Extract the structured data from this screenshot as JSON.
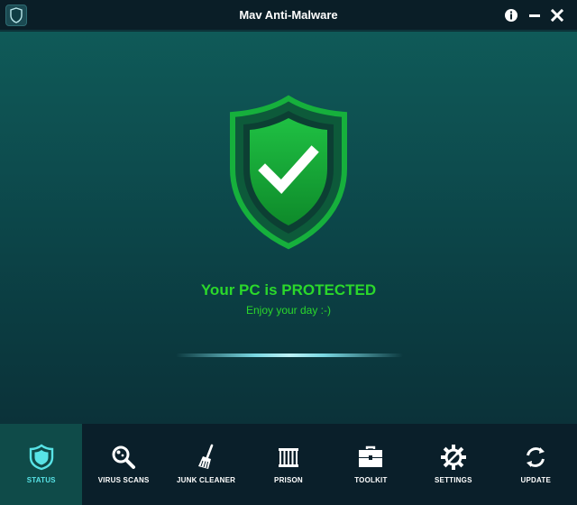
{
  "window": {
    "title": "Mav Anti-Malware"
  },
  "status": {
    "headline": "Your PC is PROTECTED",
    "subtext": "Enjoy your day :-)"
  },
  "nav": {
    "items": [
      {
        "label": "STATUS",
        "icon": "shield-icon",
        "active": true
      },
      {
        "label": "VIRUS SCANS",
        "icon": "magnifier-icon",
        "active": false
      },
      {
        "label": "JUNK CLEANER",
        "icon": "broom-icon",
        "active": false
      },
      {
        "label": "PRISON",
        "icon": "prison-bars-icon",
        "active": false
      },
      {
        "label": "TOOLKIT",
        "icon": "toolbox-icon",
        "active": false
      },
      {
        "label": "SETTINGS",
        "icon": "gear-icon",
        "active": false
      },
      {
        "label": "UPDATE",
        "icon": "refresh-icon",
        "active": false
      }
    ]
  },
  "colors": {
    "accent": "#58e3e6",
    "protected_green": "#2bd82b",
    "shield_green": "#14a02c"
  }
}
